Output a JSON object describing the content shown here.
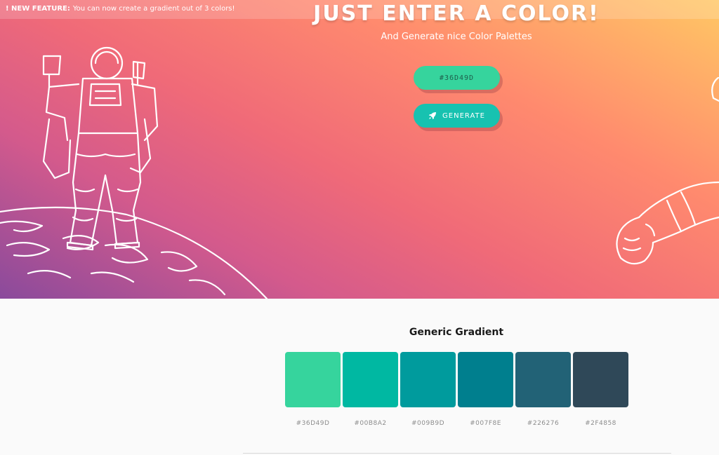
{
  "banner": {
    "strong": "! NEW FEATURE:",
    "text": "You can now create a gradient out of 3 colors!"
  },
  "hero": {
    "headline": "JUST ENTER A COLOR!",
    "subline": "And Generate nice Color Palettes",
    "input_value": "#36D49D",
    "generate_label": "GENERATE",
    "gradient_colors": [
      "#ffc764",
      "#ff8a6e",
      "#f06a78",
      "#d45a8c",
      "#8a4a9c"
    ]
  },
  "palette": {
    "title": "Generic Gradient",
    "swatches": [
      {
        "hex": "#36D49D",
        "label": "#36D49D"
      },
      {
        "hex": "#00B8A2",
        "label": "#00B8A2"
      },
      {
        "hex": "#009B9D",
        "label": "#009B9D"
      },
      {
        "hex": "#007F8E",
        "label": "#007F8E"
      },
      {
        "hex": "#226276",
        "label": "#226276"
      },
      {
        "hex": "#2F4858",
        "label": "#2F4858"
      }
    ]
  },
  "icons": {
    "generate": "rocket-icon",
    "left_illustration": "astronaut-on-planet-illustration",
    "right_illustration": "astronaut-arm-illustration"
  }
}
